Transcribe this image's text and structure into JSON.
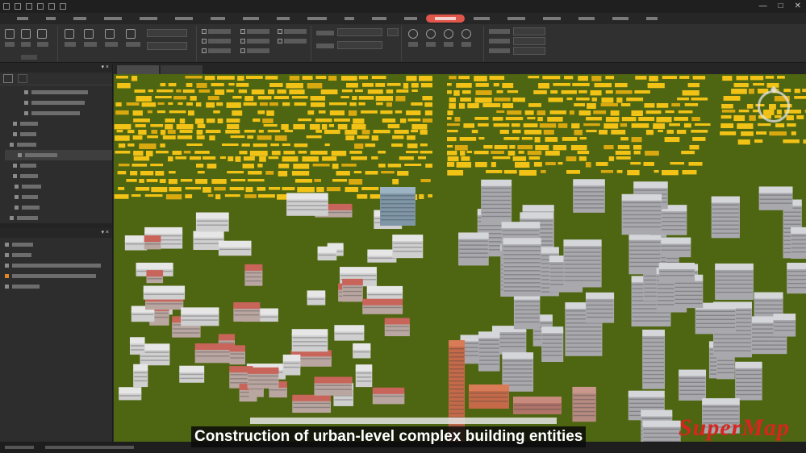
{
  "caption": "Construction of urban-level complex building entities",
  "logo": "SuperMap",
  "window": {
    "title_icon_names": [
      "app-logo-icon",
      "save-icon",
      "undo-icon",
      "redo-icon",
      "new-icon",
      "open-icon"
    ],
    "controls": [
      "minimize-icon",
      "restore-icon",
      "close-icon"
    ]
  },
  "menubar": {
    "tab_count": 20,
    "active_index": 13,
    "accent_color": "#e0564b"
  },
  "scene": {
    "ground_color": "#4e6511",
    "block_color": "#f2c316",
    "roof_red": "#c8645a",
    "building_white": "#e6e6e6",
    "building_gray": "#a9a9ad",
    "navigation_icon": "compass-ring-icon"
  },
  "colors": {
    "logo_red": "#d6261f",
    "caption_bg": "#0a0a0a"
  }
}
